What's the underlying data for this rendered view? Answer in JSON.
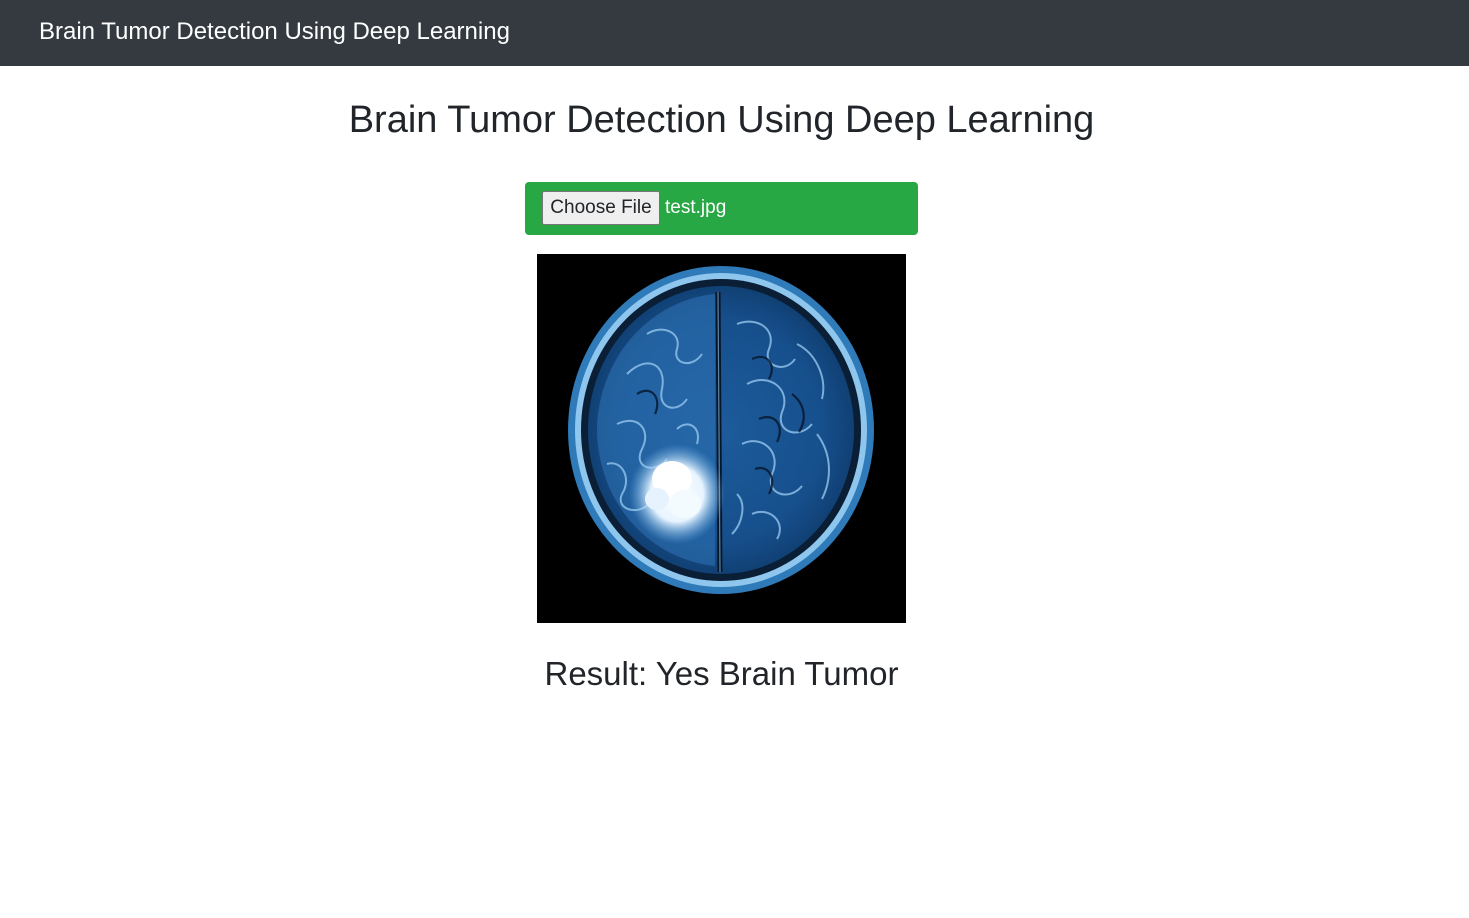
{
  "navbar": {
    "brand": "Brain Tumor Detection Using Deep Learning"
  },
  "main": {
    "title": "Brain Tumor Detection Using Deep Learning",
    "upload": {
      "button_label": "Choose File",
      "file_name": "test.jpg",
      "background_color": "#28a745"
    },
    "preview": {
      "description_icon": "brain-mri-scan"
    },
    "result": "Result: Yes Brain Tumor"
  },
  "colors": {
    "navbar_bg": "#343a40",
    "upload_bg": "#28a745",
    "text": "#212529"
  }
}
